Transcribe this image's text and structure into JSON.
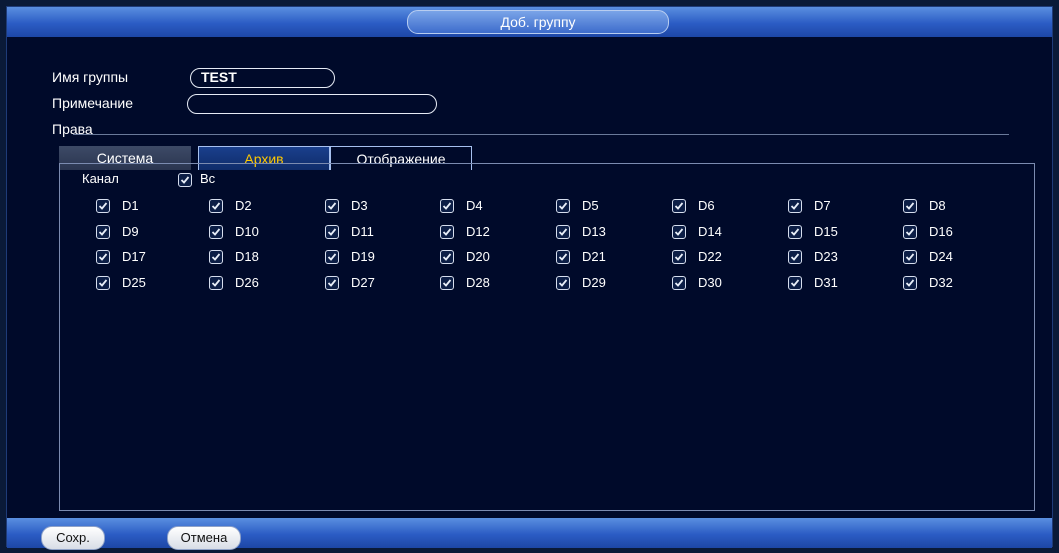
{
  "dialog": {
    "title": "Доб. группу"
  },
  "form": {
    "group_name_label": "Имя группы",
    "group_name_value": "TEST",
    "note_label": "Примечание",
    "note_value": "",
    "rights_label": "Права"
  },
  "tabs": [
    {
      "label": "Система",
      "active": false
    },
    {
      "label": "Архив",
      "active": true
    },
    {
      "label": "Отображение",
      "active": false
    }
  ],
  "channel_header": {
    "channel_label": "Канал",
    "all_label": "Вс",
    "all_checked": true
  },
  "channels": [
    "D1",
    "D2",
    "D3",
    "D4",
    "D5",
    "D6",
    "D7",
    "D8",
    "D9",
    "D10",
    "D11",
    "D12",
    "D13",
    "D14",
    "D15",
    "D16",
    "D17",
    "D18",
    "D19",
    "D20",
    "D21",
    "D22",
    "D23",
    "D24",
    "D25",
    "D26",
    "D27",
    "D28",
    "D29",
    "D30",
    "D31",
    "D32"
  ],
  "buttons": {
    "save": "Сохр.",
    "cancel": "Отмена"
  },
  "colors": {
    "active_tab_text": "#ffc800",
    "title_bar": "#2b5cc4",
    "background": "#000a2a"
  }
}
